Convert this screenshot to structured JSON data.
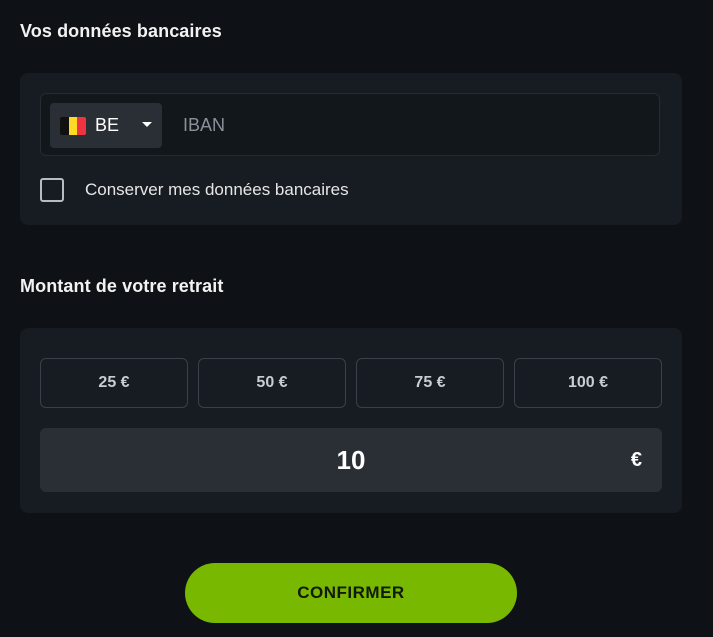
{
  "bank_section": {
    "title": "Vos données bancaires",
    "country": {
      "code": "BE",
      "flag_icon": "belgium-flag-icon",
      "chevron_icon": "chevron-down-icon"
    },
    "iban": {
      "placeholder": "IBAN",
      "value": ""
    },
    "save_checkbox": {
      "label": "Conserver mes données bancaires",
      "checked": false
    }
  },
  "amount_section": {
    "title": "Montant de votre retrait",
    "presets": [
      {
        "label": "25 €"
      },
      {
        "label": "50 €"
      },
      {
        "label": "75 €"
      },
      {
        "label": "100 €"
      }
    ],
    "amount": {
      "value": "10",
      "currency": "€"
    }
  },
  "confirm_button": {
    "label": "CONFIRMER"
  },
  "colors": {
    "background": "#0e1216",
    "card": "#171c22",
    "accent": "#78b800"
  }
}
